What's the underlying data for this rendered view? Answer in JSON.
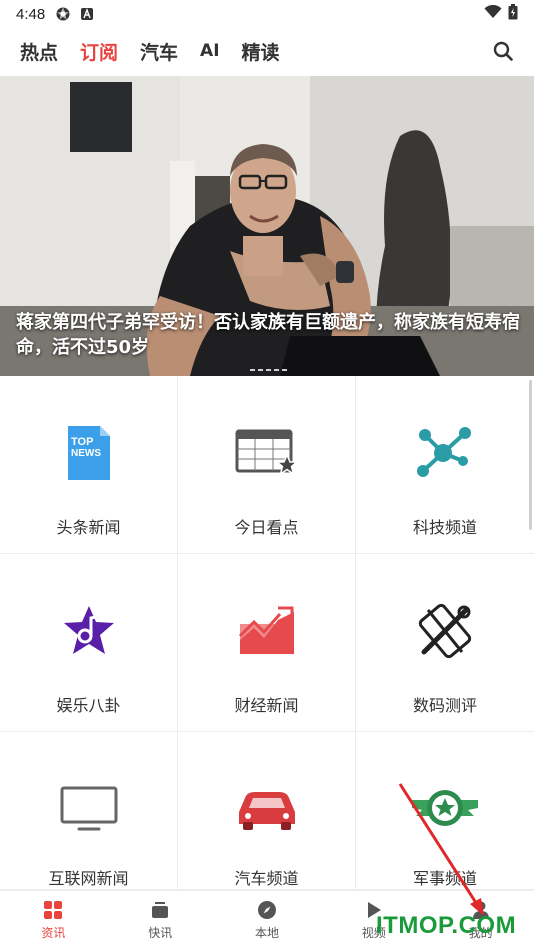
{
  "status_bar": {
    "time": "4:48"
  },
  "top_tabs": [
    {
      "label": "热点",
      "active": false
    },
    {
      "label": "订阅",
      "active": true
    },
    {
      "label": "汽车",
      "active": false
    },
    {
      "label": "AI",
      "active": false
    },
    {
      "label": "精读",
      "active": false
    }
  ],
  "hero": {
    "caption": "蒋家第四代子弟罕受访！否认家族有巨额遗产，称家族有短寿宿命，活不过50岁"
  },
  "categories": [
    {
      "label": "头条新闻",
      "icon": "top-news-icon"
    },
    {
      "label": "今日看点",
      "icon": "calendar-star-icon"
    },
    {
      "label": "科技频道",
      "icon": "molecule-icon"
    },
    {
      "label": "娱乐八卦",
      "icon": "star-music-icon"
    },
    {
      "label": "财经新闻",
      "icon": "finance-chart-icon"
    },
    {
      "label": "数码测评",
      "icon": "tools-phone-icon"
    },
    {
      "label": "互联网新闻",
      "icon": "monitor-icon"
    },
    {
      "label": "汽车频道",
      "icon": "car-icon"
    },
    {
      "label": "军事频道",
      "icon": "military-badge-icon"
    }
  ],
  "bottom_nav": [
    {
      "label": "资讯",
      "icon": "grid-icon",
      "active": true
    },
    {
      "label": "快讯",
      "icon": "stack-icon",
      "active": false
    },
    {
      "label": "本地",
      "icon": "compass-icon",
      "active": false
    },
    {
      "label": "视频",
      "icon": "play-icon",
      "active": false
    },
    {
      "label": "我的",
      "icon": "user-icon",
      "active": false
    }
  ],
  "watermark": "ITMOP.COM",
  "colors": {
    "accent": "#e8433f",
    "watermark": "#1a9a3a"
  }
}
